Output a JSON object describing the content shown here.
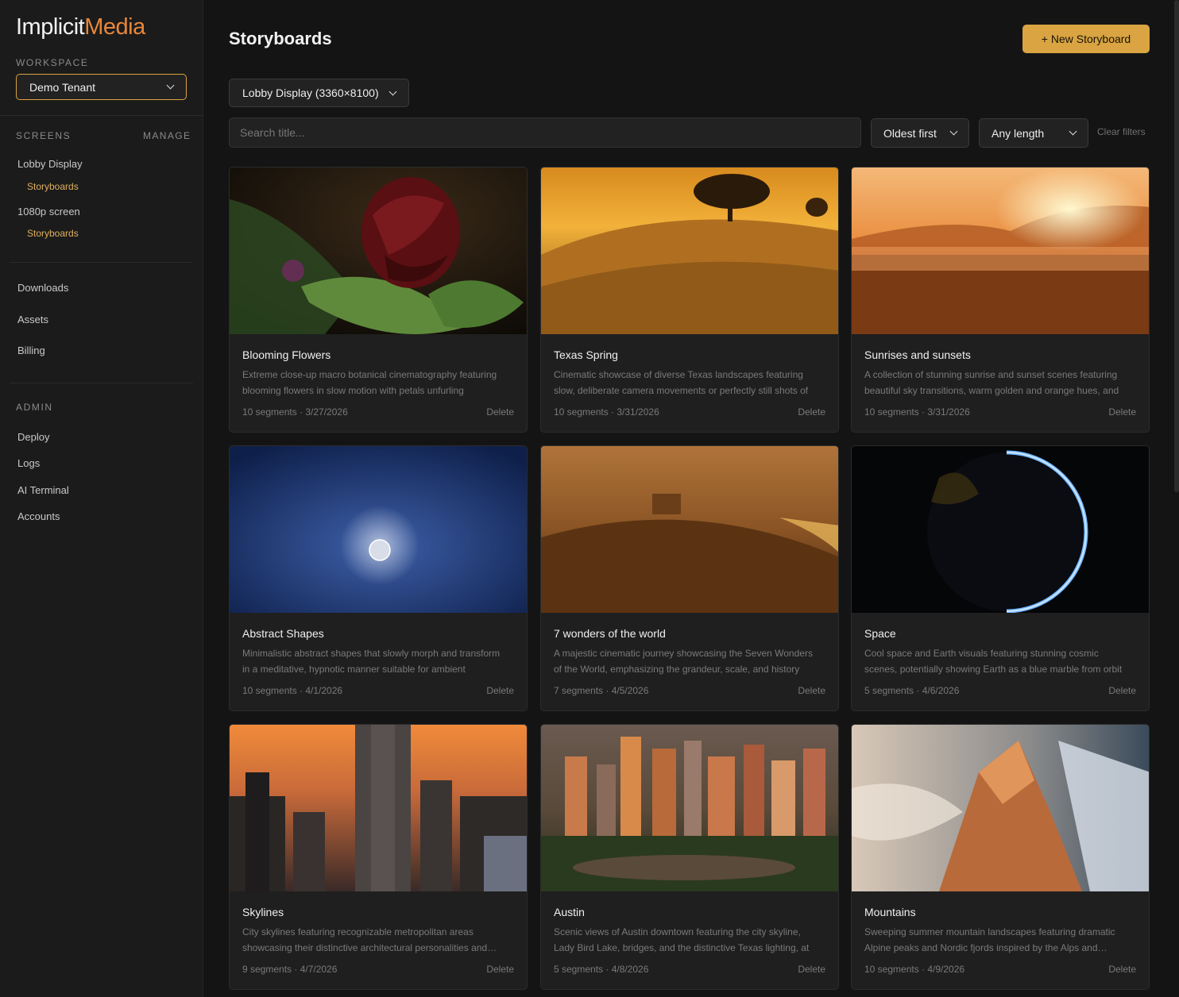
{
  "brand": {
    "word1": "Implicit",
    "word2": "Media"
  },
  "workspace": {
    "label": "WORKSPACE",
    "selected": "Demo Tenant"
  },
  "screens": {
    "label": "SCREENS",
    "manage": "MANAGE",
    "items": [
      {
        "name": "Lobby Display",
        "sub": "Storyboards"
      },
      {
        "name": "1080p screen",
        "sub": "Storyboards"
      }
    ]
  },
  "nav": {
    "downloads": "Downloads",
    "assets": "Assets",
    "billing": "Billing"
  },
  "admin": {
    "label": "ADMIN",
    "deploy": "Deploy",
    "logs": "Logs",
    "ai_terminal": "AI Terminal",
    "accounts": "Accounts"
  },
  "header": {
    "title": "Storyboards",
    "new_button": "+ New Storyboard"
  },
  "filters": {
    "screen": "Lobby Display (3360×8100)",
    "search_placeholder": "Search title...",
    "sort": "Oldest first",
    "length": "Any length",
    "clear": "Clear filters"
  },
  "cards": [
    {
      "title": "Blooming Flowers",
      "desc": "Extreme close-up macro botanical cinematography featuring blooming flowers in slow motion with petals unfurling",
      "meta": "10 segments · 3/27/2026",
      "delete": "Delete"
    },
    {
      "title": "Texas Spring",
      "desc": "Cinematic showcase of diverse Texas landscapes featuring slow, deliberate camera movements or perfectly still shots of",
      "meta": "10 segments · 3/31/2026",
      "delete": "Delete"
    },
    {
      "title": "Sunrises and sunsets",
      "desc": "A collection of stunning sunrise and sunset scenes featuring beautiful sky transitions, warm golden and orange hues, and",
      "meta": "10 segments · 3/31/2026",
      "delete": "Delete"
    },
    {
      "title": "Abstract Shapes",
      "desc": "Minimalistic abstract shapes that slowly morph and transform in a meditative, hypnotic manner suitable for ambient",
      "meta": "10 segments · 4/1/2026",
      "delete": "Delete"
    },
    {
      "title": "7 wonders of the world",
      "desc": "A majestic cinematic journey showcasing the Seven Wonders of the World, emphasizing the grandeur, scale, and history",
      "meta": "7 segments · 4/5/2026",
      "delete": "Delete"
    },
    {
      "title": "Space",
      "desc": "Cool space and Earth visuals featuring stunning cosmic scenes, potentially showing Earth as a blue marble from orbit",
      "meta": "5 segments · 4/6/2026",
      "delete": "Delete"
    },
    {
      "title": "Skylines",
      "desc": "City skylines featuring recognizable metropolitan areas showcasing their distinctive architectural personalities and character",
      "meta": "9 segments · 4/7/2026",
      "delete": "Delete"
    },
    {
      "title": "Austin",
      "desc": "Scenic views of Austin downtown featuring the city skyline, Lady Bird Lake, bridges, and the distinctive Texas lighting, at",
      "meta": "5 segments · 4/8/2026",
      "delete": "Delete"
    },
    {
      "title": "Mountains",
      "desc": "Sweeping summer mountain landscapes featuring dramatic Alpine peaks and Nordic fjords inspired by the Alps and Norway",
      "meta": "10 segments · 4/9/2026",
      "delete": "Delete"
    }
  ],
  "colors": {
    "accent": "#d9a441",
    "brand_orange": "#e8873a",
    "bg": "#141414",
    "sidebar": "#1b1b1b"
  }
}
